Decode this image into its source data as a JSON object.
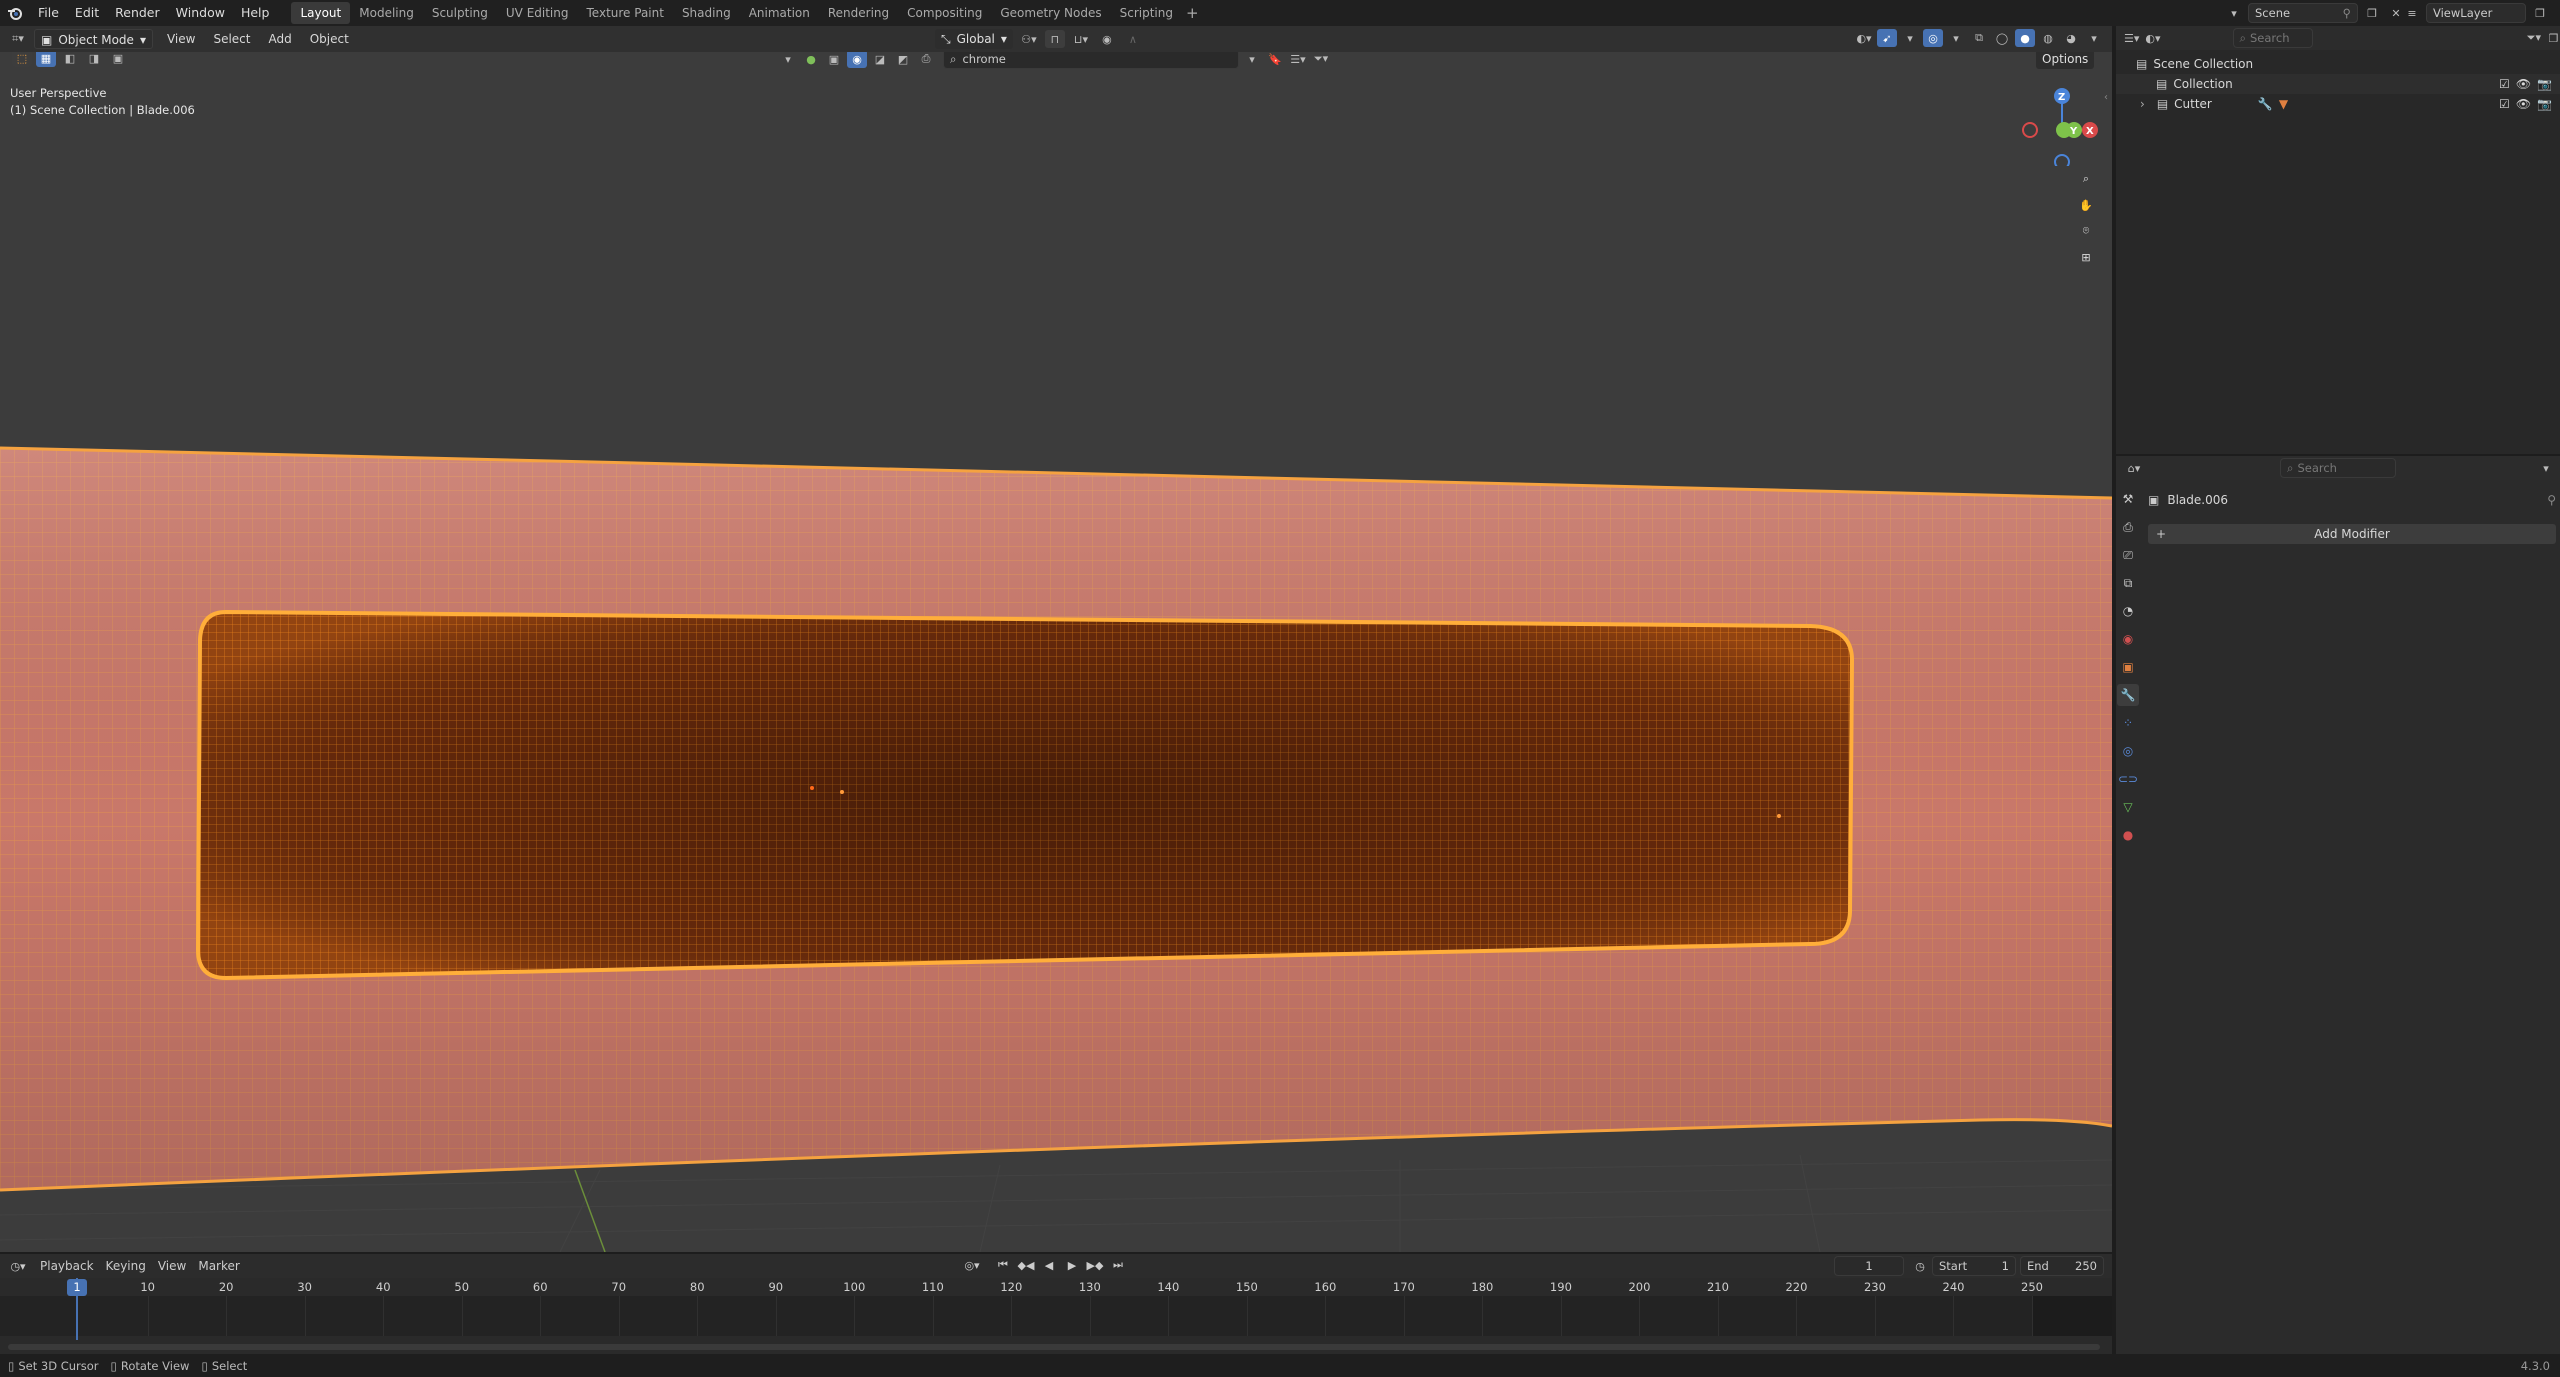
{
  "menus": [
    "File",
    "Edit",
    "Render",
    "Window",
    "Help"
  ],
  "workspaces": [
    "Layout",
    "Modeling",
    "Sculpting",
    "UV Editing",
    "Texture Paint",
    "Shading",
    "Animation",
    "Rendering",
    "Compositing",
    "Geometry Nodes",
    "Scripting"
  ],
  "active_workspace": "Layout",
  "add_workspace": "+",
  "scene": "Scene",
  "view_layer": "ViewLayer",
  "top_search_placeholder": "Search",
  "viewport": {
    "mode": "Object Mode",
    "menus": [
      "View",
      "Select",
      "Add",
      "Object"
    ],
    "orientation": "Global",
    "search_value": "chrome",
    "options_label": "Options",
    "overlay_line1": "User Perspective",
    "overlay_line2": "(1) Scene Collection | Blade.006",
    "gizmo": {
      "z": "Z",
      "y": "Y",
      "x": "X"
    }
  },
  "outliner": {
    "search_placeholder": "Search",
    "items": [
      {
        "label": "Scene Collection"
      },
      {
        "label": "Collection"
      },
      {
        "label": "Cutter"
      }
    ]
  },
  "properties": {
    "search_placeholder": "Search",
    "object_name": "Blade.006",
    "add_modifier": "Add Modifier"
  },
  "timeline": {
    "menus": [
      "Playback",
      "Keying",
      "View",
      "Marker"
    ],
    "current_frame": "1",
    "start_label": "Start",
    "start_value": "1",
    "end_label": "End",
    "end_value": "250",
    "ticks": [
      1,
      10,
      20,
      30,
      40,
      50,
      60,
      70,
      80,
      90,
      100,
      110,
      120,
      130,
      140,
      150,
      160,
      170,
      180,
      190,
      200,
      210,
      220,
      230,
      240,
      250
    ]
  },
  "status": {
    "hint1": "Set 3D Cursor",
    "hint2": "Rotate View",
    "hint3": "Select",
    "version": "4.3.0"
  },
  "colors": {
    "accent": "#4772b3",
    "mesh_fill": "#c97a6a",
    "selection_orange": "#f08a1c",
    "background": "#3c3c3c"
  }
}
